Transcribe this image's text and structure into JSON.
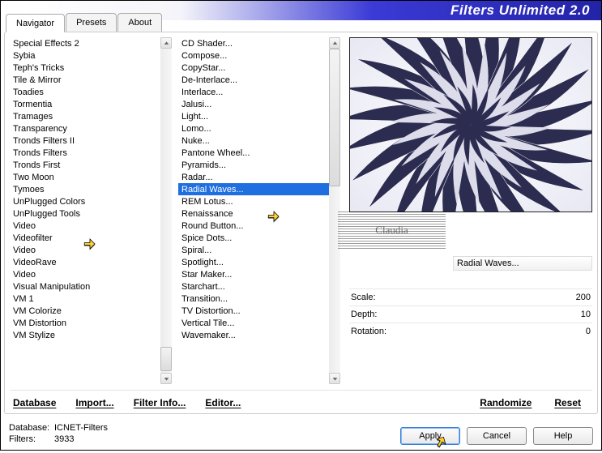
{
  "title": "Filters Unlimited 2.0",
  "tabs": [
    "Navigator",
    "Presets",
    "About"
  ],
  "active_tab": 0,
  "categories": [
    "Special Effects 2",
    "Sybia",
    "Teph's Tricks",
    "Tile & Mirror",
    "Toadies",
    "Tormentia",
    "Tramages",
    "Transparency",
    "Tronds Filters II",
    "Tronds Filters",
    "Tronds First",
    "Two Moon",
    "Tymoes",
    "UnPlugged Colors",
    "UnPlugged Tools",
    "Video",
    "Videofilter",
    "Video",
    "VideoRave",
    "Video",
    "Visual Manipulation",
    "VM 1",
    "VM Colorize",
    "VM Distortion",
    "VM Stylize"
  ],
  "filters": [
    "CD Shader...",
    "Compose...",
    "CopyStar...",
    "De-Interlace...",
    "Interlace...",
    "Jalusi...",
    "Light...",
    "Lomo...",
    "Nuke...",
    "Pantone Wheel...",
    "Pyramids...",
    "Radar...",
    "Radial Waves...",
    "REM Lotus...",
    "Renaissance",
    "Round Button...",
    "Spice Dots...",
    "Spiral...",
    "Spotlight...",
    "Star Maker...",
    "Starchart...",
    "Transition...",
    "TV Distortion...",
    "Vertical Tile...",
    "Wavemaker..."
  ],
  "selected_filter_index": 12,
  "selected_category_index": 14,
  "filter_name_box": "Radial Waves...",
  "params": [
    {
      "label": "Scale:",
      "value": "200"
    },
    {
      "label": "Depth:",
      "value": "10"
    },
    {
      "label": "Rotation:",
      "value": "0"
    }
  ],
  "linkbar": [
    "Database",
    "Import...",
    "Filter Info...",
    "Editor..."
  ],
  "linkbar2": [
    "Randomize",
    "Reset"
  ],
  "database": {
    "label": "Database:",
    "value": "ICNET-Filters"
  },
  "filters_count": {
    "label": "Filters:",
    "value": "3933"
  },
  "buttons": {
    "apply": "Apply",
    "cancel": "Cancel",
    "help": "Help"
  },
  "watermark": "Claudia"
}
